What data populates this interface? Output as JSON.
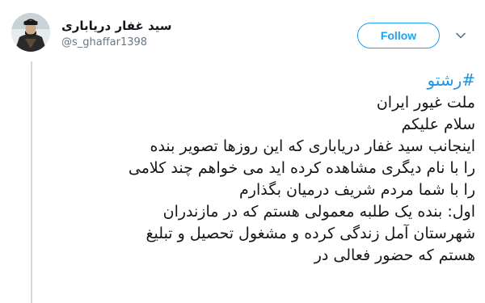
{
  "user": {
    "display_name": "سید غفار دریاباری",
    "handle": "@s_ghaffar1398"
  },
  "follow": {
    "label": "Follow"
  },
  "icons": {
    "avatar": "user-avatar",
    "menu": "chevron-down-icon"
  },
  "tweet": {
    "hashtag": "#رشتو",
    "lines": [
      "ملت غیور ایران",
      "سلام علیکم",
      "اینجانب سید غفار دریاباری که این روزها تصویر بنده",
      "را با نام دیگری مشاهده کرده اید می خواهم چند کلامی",
      "را با شما مردم شریف درمیان بگذارم",
      "اول: بنده یک طلبه معمولی هستم که در مازندران",
      "شهرستان آمل زندگی کرده و مشغول تحصیل و تبلیغ",
      "هستم که حضور فعالی در"
    ]
  },
  "colors": {
    "accent": "#1da1f2",
    "hashtag": "#1b95e0",
    "text": "#14171a",
    "secondary": "#657786",
    "thread_line": "#cfd9de"
  }
}
